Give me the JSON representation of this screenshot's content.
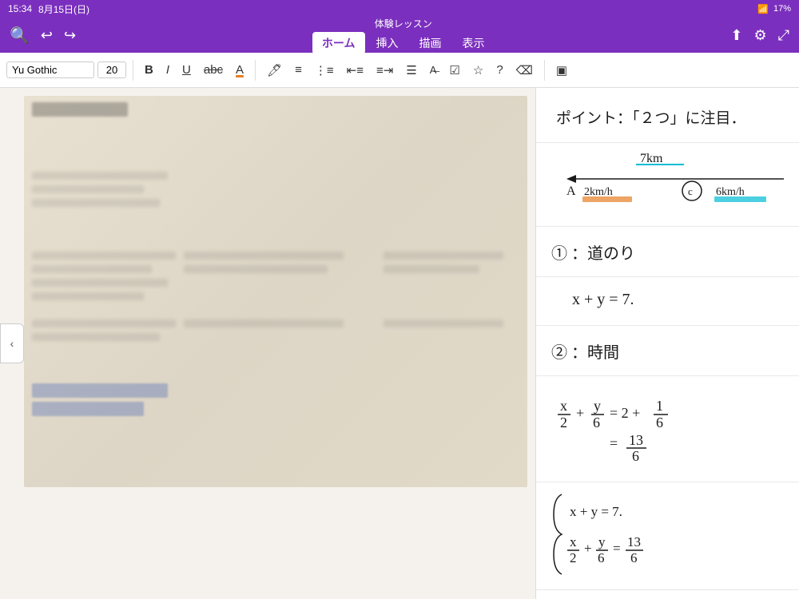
{
  "statusBar": {
    "time": "15:34",
    "date": "8月15日(日)",
    "wifi": "WiFi",
    "battery": "17%"
  },
  "navBar": {
    "title": "体験レッスン",
    "tabs": [
      "ホーム",
      "挿入",
      "描画",
      "表示"
    ],
    "activeTab": "ホーム"
  },
  "toolbar": {
    "fontName": "Yu Gothic",
    "fontSize": "20",
    "buttons": {
      "bold": "B",
      "italic": "I",
      "underline": "U",
      "strikethrough": "abc",
      "fontColor": "A"
    }
  },
  "leftPanel": {
    "navButtonLabel": "‹"
  },
  "rightPanel": {
    "section1": {
      "label": "ポイント：「２つ」に注目．"
    },
    "section2": {
      "distanceLabel": "7km",
      "pointA": "A",
      "speed1": "2km/h",
      "pointC": "©",
      "speed2": "6km/h"
    },
    "section3": {
      "number": "①",
      "label": "：道のり"
    },
    "section4": {
      "equation": "x + y = 7."
    },
    "section5": {
      "number": "②",
      "label": "：時間"
    },
    "section6": {
      "eq1": "x/2 + y/6 = 2 + 1/6",
      "eq2": "= 13/6"
    },
    "section7": {
      "sys1": "x + y = 7.",
      "sys2": "x/2 + y/6 = 13/6"
    }
  }
}
